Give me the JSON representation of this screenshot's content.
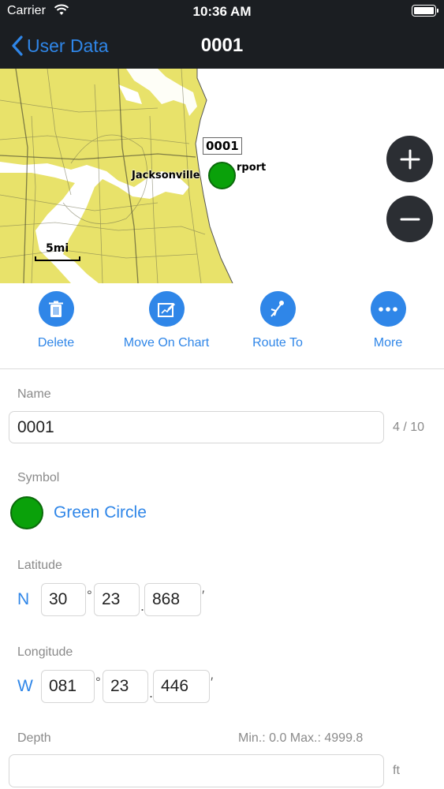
{
  "status_bar": {
    "carrier": "Carrier",
    "time": "10:36 AM"
  },
  "nav": {
    "back_label": "User Data",
    "title": "0001"
  },
  "map": {
    "waypoint_label": "0001",
    "city_label": "Jacksonville",
    "poi_label": "rport",
    "scale_label": "5mi",
    "land_color": "#e8e26a",
    "water_color": "#ffffff"
  },
  "actions": [
    {
      "label": "Delete",
      "icon": "trash-icon"
    },
    {
      "label": "Move On Chart",
      "icon": "move-on-chart-icon"
    },
    {
      "label": "Route To",
      "icon": "route-to-icon"
    },
    {
      "label": "More",
      "icon": "ellipsis-icon"
    }
  ],
  "form": {
    "name": {
      "label": "Name",
      "value": "0001",
      "counter": "4 / 10"
    },
    "symbol": {
      "label": "Symbol",
      "value": "Green Circle",
      "color": "#0aa10a"
    },
    "latitude": {
      "label": "Latitude",
      "hemisphere": "N",
      "degrees": "30",
      "minutes": "23",
      "decimal": "868"
    },
    "longitude": {
      "label": "Longitude",
      "hemisphere": "W",
      "degrees": "081",
      "minutes": "23",
      "decimal": "446"
    },
    "depth": {
      "label": "Depth",
      "range": "Min.: 0.0 Max.: 4999.8",
      "value": "",
      "unit": "ft"
    }
  },
  "colors": {
    "accent": "#2f86e8",
    "navbar": "#1b1e22"
  }
}
